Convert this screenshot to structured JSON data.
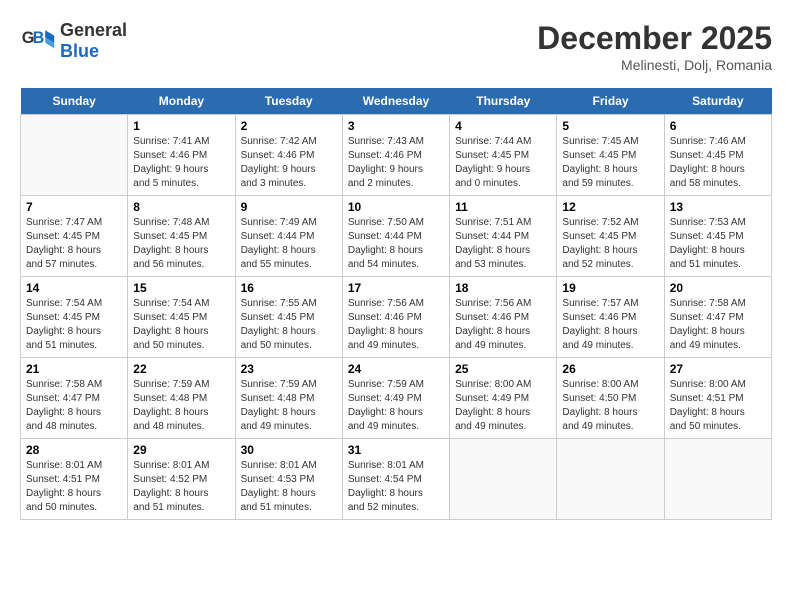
{
  "header": {
    "logo_line1": "General",
    "logo_line2": "Blue",
    "month": "December 2025",
    "location": "Melinesti, Dolj, Romania"
  },
  "days": [
    "Sunday",
    "Monday",
    "Tuesday",
    "Wednesday",
    "Thursday",
    "Friday",
    "Saturday"
  ],
  "weeks": [
    [
      {
        "date": "",
        "info": ""
      },
      {
        "date": "1",
        "info": "Sunrise: 7:41 AM\nSunset: 4:46 PM\nDaylight: 9 hours\nand 5 minutes."
      },
      {
        "date": "2",
        "info": "Sunrise: 7:42 AM\nSunset: 4:46 PM\nDaylight: 9 hours\nand 3 minutes."
      },
      {
        "date": "3",
        "info": "Sunrise: 7:43 AM\nSunset: 4:46 PM\nDaylight: 9 hours\nand 2 minutes."
      },
      {
        "date": "4",
        "info": "Sunrise: 7:44 AM\nSunset: 4:45 PM\nDaylight: 9 hours\nand 0 minutes."
      },
      {
        "date": "5",
        "info": "Sunrise: 7:45 AM\nSunset: 4:45 PM\nDaylight: 8 hours\nand 59 minutes."
      },
      {
        "date": "6",
        "info": "Sunrise: 7:46 AM\nSunset: 4:45 PM\nDaylight: 8 hours\nand 58 minutes."
      }
    ],
    [
      {
        "date": "7",
        "info": "Sunrise: 7:47 AM\nSunset: 4:45 PM\nDaylight: 8 hours\nand 57 minutes."
      },
      {
        "date": "8",
        "info": "Sunrise: 7:48 AM\nSunset: 4:45 PM\nDaylight: 8 hours\nand 56 minutes."
      },
      {
        "date": "9",
        "info": "Sunrise: 7:49 AM\nSunset: 4:44 PM\nDaylight: 8 hours\nand 55 minutes."
      },
      {
        "date": "10",
        "info": "Sunrise: 7:50 AM\nSunset: 4:44 PM\nDaylight: 8 hours\nand 54 minutes."
      },
      {
        "date": "11",
        "info": "Sunrise: 7:51 AM\nSunset: 4:44 PM\nDaylight: 8 hours\nand 53 minutes."
      },
      {
        "date": "12",
        "info": "Sunrise: 7:52 AM\nSunset: 4:45 PM\nDaylight: 8 hours\nand 52 minutes."
      },
      {
        "date": "13",
        "info": "Sunrise: 7:53 AM\nSunset: 4:45 PM\nDaylight: 8 hours\nand 51 minutes."
      }
    ],
    [
      {
        "date": "14",
        "info": "Sunrise: 7:54 AM\nSunset: 4:45 PM\nDaylight: 8 hours\nand 51 minutes."
      },
      {
        "date": "15",
        "info": "Sunrise: 7:54 AM\nSunset: 4:45 PM\nDaylight: 8 hours\nand 50 minutes."
      },
      {
        "date": "16",
        "info": "Sunrise: 7:55 AM\nSunset: 4:45 PM\nDaylight: 8 hours\nand 50 minutes."
      },
      {
        "date": "17",
        "info": "Sunrise: 7:56 AM\nSunset: 4:46 PM\nDaylight: 8 hours\nand 49 minutes."
      },
      {
        "date": "18",
        "info": "Sunrise: 7:56 AM\nSunset: 4:46 PM\nDaylight: 8 hours\nand 49 minutes."
      },
      {
        "date": "19",
        "info": "Sunrise: 7:57 AM\nSunset: 4:46 PM\nDaylight: 8 hours\nand 49 minutes."
      },
      {
        "date": "20",
        "info": "Sunrise: 7:58 AM\nSunset: 4:47 PM\nDaylight: 8 hours\nand 49 minutes."
      }
    ],
    [
      {
        "date": "21",
        "info": "Sunrise: 7:58 AM\nSunset: 4:47 PM\nDaylight: 8 hours\nand 48 minutes."
      },
      {
        "date": "22",
        "info": "Sunrise: 7:59 AM\nSunset: 4:48 PM\nDaylight: 8 hours\nand 48 minutes."
      },
      {
        "date": "23",
        "info": "Sunrise: 7:59 AM\nSunset: 4:48 PM\nDaylight: 8 hours\nand 49 minutes."
      },
      {
        "date": "24",
        "info": "Sunrise: 7:59 AM\nSunset: 4:49 PM\nDaylight: 8 hours\nand 49 minutes."
      },
      {
        "date": "25",
        "info": "Sunrise: 8:00 AM\nSunset: 4:49 PM\nDaylight: 8 hours\nand 49 minutes."
      },
      {
        "date": "26",
        "info": "Sunrise: 8:00 AM\nSunset: 4:50 PM\nDaylight: 8 hours\nand 49 minutes."
      },
      {
        "date": "27",
        "info": "Sunrise: 8:00 AM\nSunset: 4:51 PM\nDaylight: 8 hours\nand 50 minutes."
      }
    ],
    [
      {
        "date": "28",
        "info": "Sunrise: 8:01 AM\nSunset: 4:51 PM\nDaylight: 8 hours\nand 50 minutes."
      },
      {
        "date": "29",
        "info": "Sunrise: 8:01 AM\nSunset: 4:52 PM\nDaylight: 8 hours\nand 51 minutes."
      },
      {
        "date": "30",
        "info": "Sunrise: 8:01 AM\nSunset: 4:53 PM\nDaylight: 8 hours\nand 51 minutes."
      },
      {
        "date": "31",
        "info": "Sunrise: 8:01 AM\nSunset: 4:54 PM\nDaylight: 8 hours\nand 52 minutes."
      },
      {
        "date": "",
        "info": ""
      },
      {
        "date": "",
        "info": ""
      },
      {
        "date": "",
        "info": ""
      }
    ]
  ]
}
